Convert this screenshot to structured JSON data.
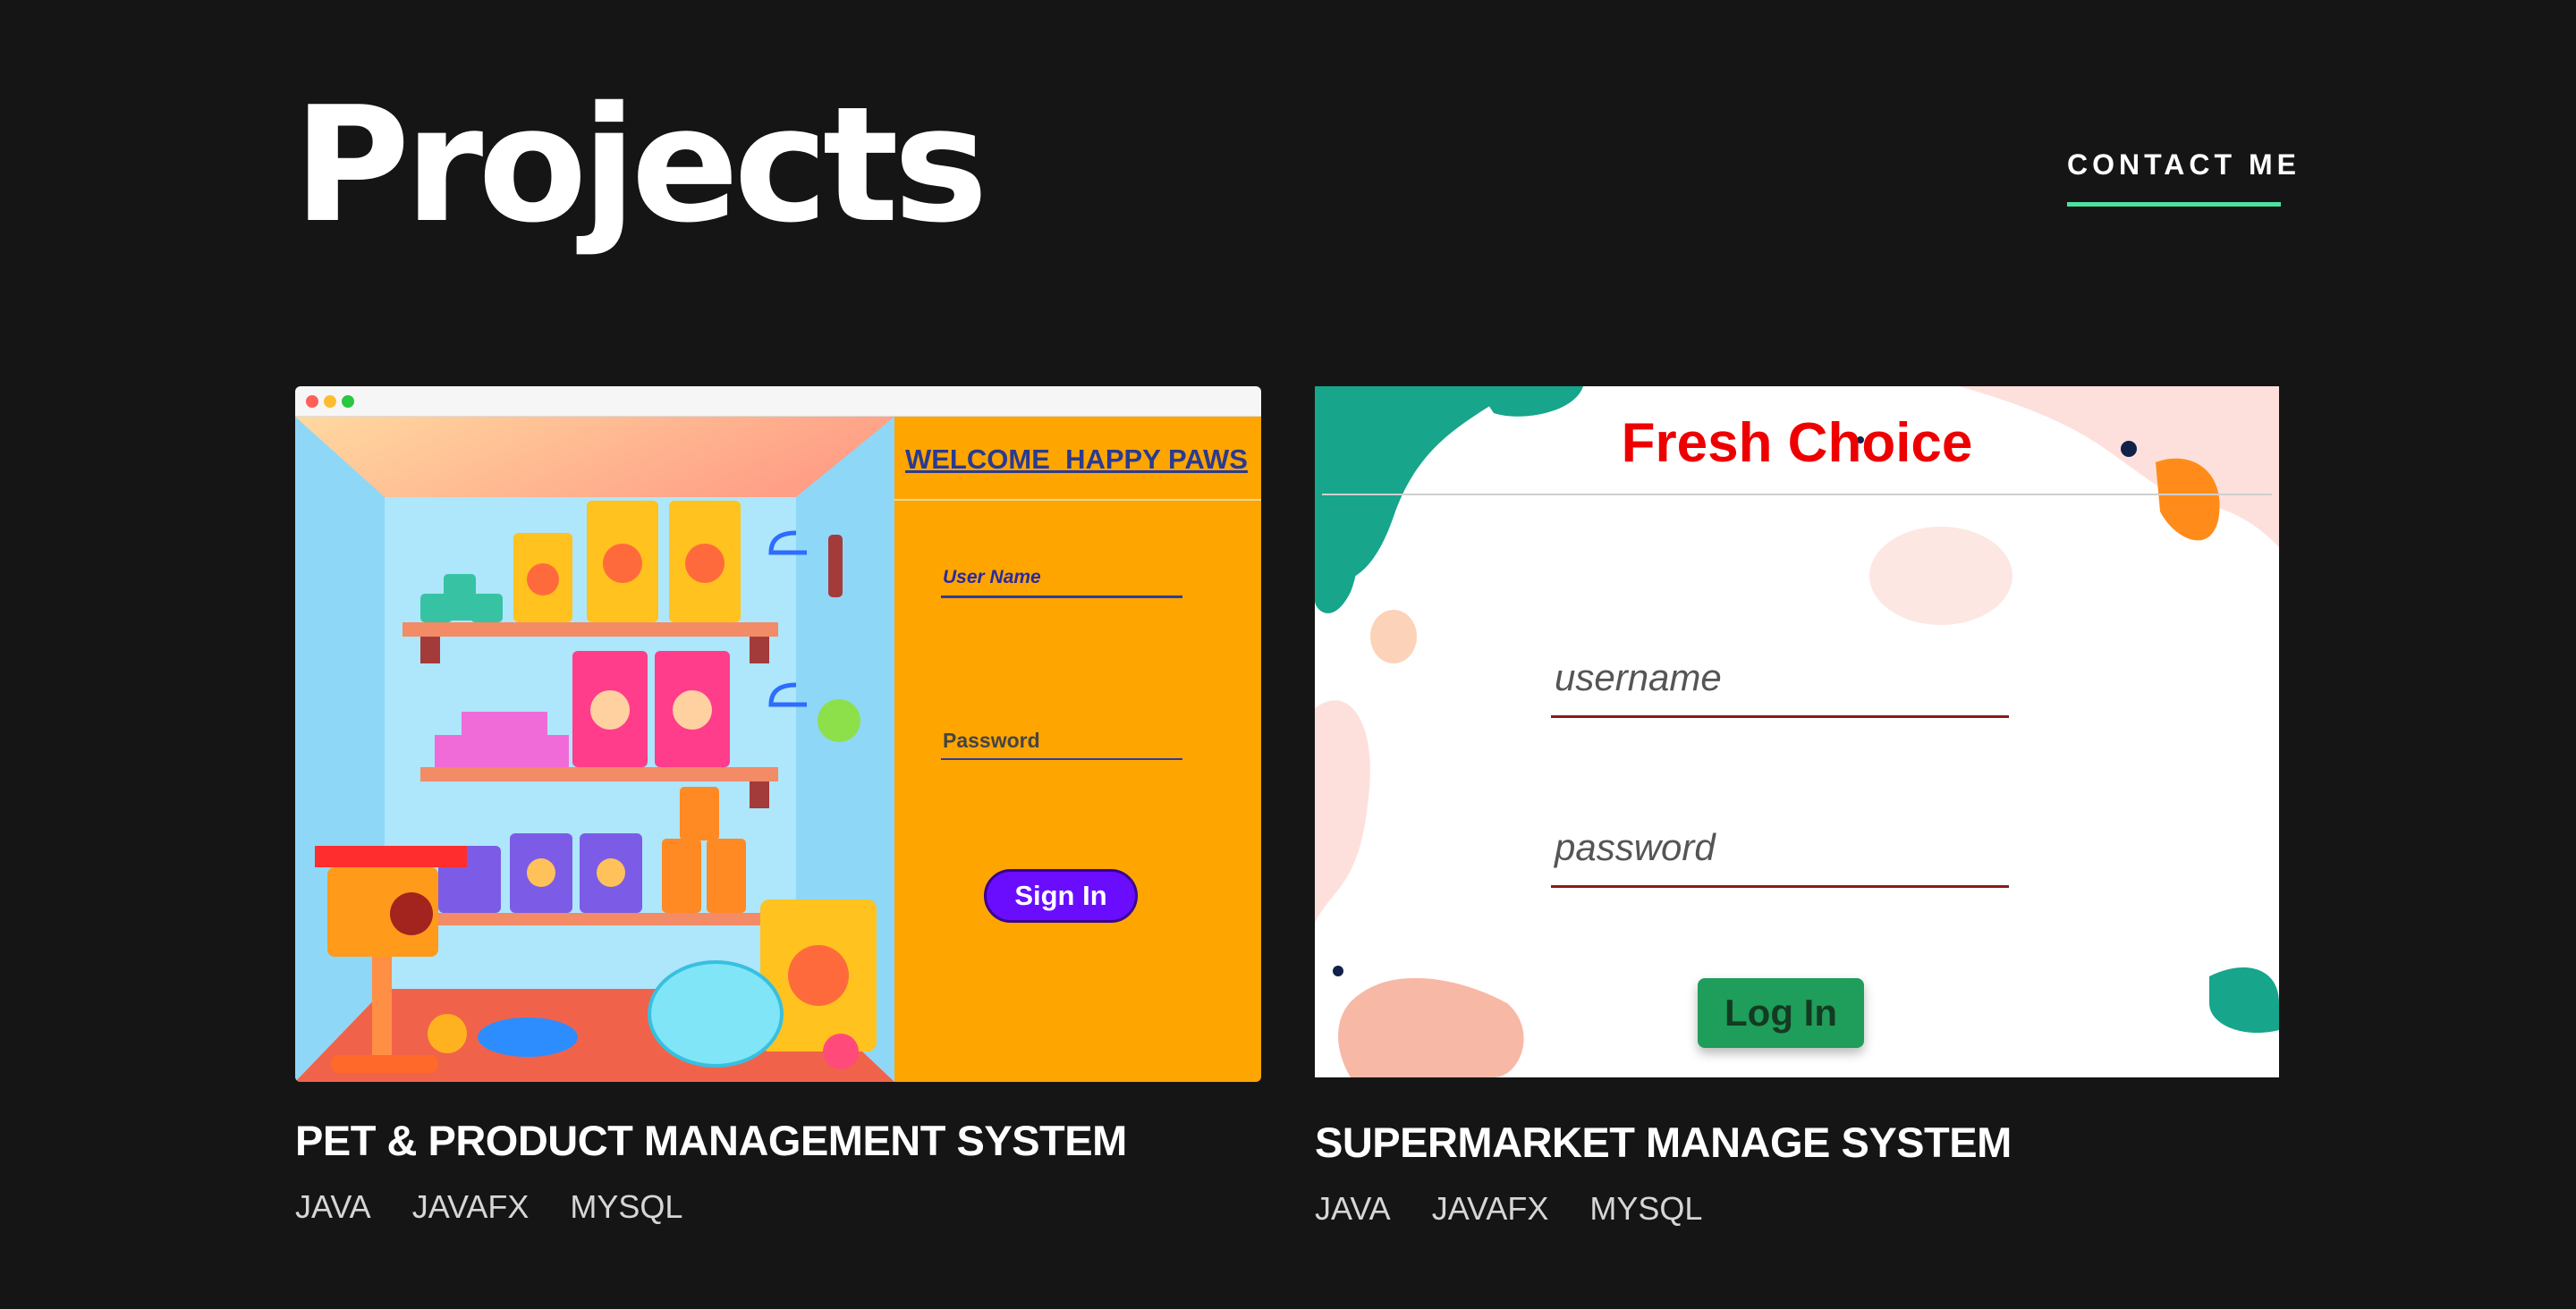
{
  "header": {
    "title": "Projects",
    "contact_label": "CONTACT ME",
    "accent_color": "#4ee1a0"
  },
  "projects": [
    {
      "title": "PET & PRODUCT MANAGEMENT SYSTEM",
      "tags": [
        "JAVA",
        "JAVAFX",
        "MYSQL"
      ],
      "thumbnail": {
        "welcome": "WELCOME  HAPPY PAWS",
        "username_label": "User Name",
        "password_label": "Password",
        "button_label": "Sign In",
        "panel_color": "#ffa500",
        "button_color": "#6a0dff"
      }
    },
    {
      "title": "SUPERMARKET MANAGE SYSTEM",
      "tags": [
        "JAVA",
        "JAVAFX",
        "MYSQL"
      ],
      "thumbnail": {
        "heading": "Fresh Choice",
        "username_placeholder": "username",
        "password_placeholder": "password",
        "button_label": "Log In",
        "heading_color": "#ee0000",
        "button_color": "#1f9d5b"
      }
    }
  ]
}
